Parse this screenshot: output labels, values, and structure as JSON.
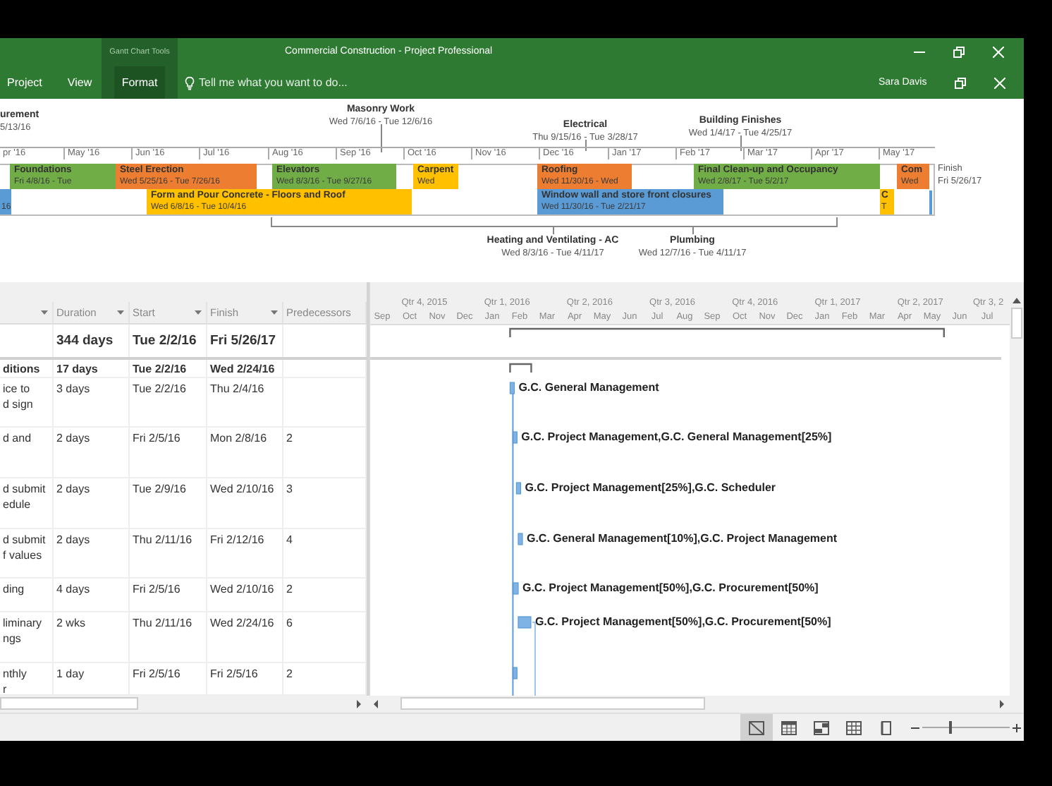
{
  "window": {
    "context_group": "Gantt Chart Tools",
    "title": "Commercial Construction - Project Professional",
    "user": "Sara Davis"
  },
  "ribbon_tabs": [
    {
      "label": "Project",
      "selected": false,
      "contextual": false
    },
    {
      "label": "View",
      "selected": false,
      "contextual": false
    },
    {
      "label": "Format",
      "selected": true,
      "contextual": true
    }
  ],
  "tell_me": {
    "placeholder": "Tell me what you want to do..."
  },
  "timeline": {
    "callouts_above": [
      {
        "name": "urement",
        "dates": "5/13/16"
      },
      {
        "name": "Masonry Work",
        "dates": "Wed 7/6/16 - Tue 12/6/16"
      },
      {
        "name": "Electrical",
        "dates": "Thu 9/15/16 - Tue 3/28/17"
      },
      {
        "name": "Building Finishes",
        "dates": "Wed 1/4/17 - Tue 4/25/17"
      }
    ],
    "months": [
      "pr '16",
      "May '16",
      "Jun '16",
      "Jul '16",
      "Aug '16",
      "Sep '16",
      "Oct '16",
      "Nov '16",
      "Dec '16",
      "Jan '17",
      "Feb '17",
      "Mar '17",
      "Apr '17",
      "May '17"
    ],
    "bars": [
      {
        "name": "Foundations",
        "dates": "Fri 4/8/16 - Tue",
        "color": "#70ad47"
      },
      {
        "name": "Steel Erection",
        "dates": "Wed 5/25/16 - Tue 7/26/16",
        "color": "#ed7d31"
      },
      {
        "name": "Elevators",
        "dates": "Wed 8/3/16 - Tue 9/27/16",
        "color": "#70ad47"
      },
      {
        "name": "Carpent",
        "dates": "Wed",
        "color": "#ffc000"
      },
      {
        "name": "Roofing",
        "dates": "Wed 11/30/16 - Wed",
        "color": "#ed7d31"
      },
      {
        "name": "Final Clean-up and Occupancy",
        "dates": "Wed 2/8/17 - Tue 5/2/17",
        "color": "#70ad47"
      },
      {
        "name": "Com",
        "dates": "Wed",
        "color": "#ed7d31"
      },
      {
        "dates": "16",
        "color": "#5b9bd5"
      },
      {
        "name": "Form and Pour Concrete - Floors and Roof",
        "dates": "Wed 6/8/16 - Tue 10/4/16",
        "color": "#ffc000"
      },
      {
        "name": "Window wall and store front closures",
        "dates": "Wed 11/30/16 - Tue 2/21/17",
        "color": "#5b9bd5"
      },
      {
        "name": "C",
        "dates": "T",
        "color": "#ffc000"
      }
    ],
    "finish": {
      "label": "Finish",
      "date": "Fri 5/26/17"
    },
    "callouts_below": [
      {
        "name": "Heating and Ventilating - AC",
        "dates": "Wed 8/3/16 - Tue 4/11/17"
      },
      {
        "name": "Plumbing",
        "dates": "Wed 12/7/16 - Tue 4/11/17"
      }
    ]
  },
  "table": {
    "columns": [
      "Duration",
      "Start",
      "Finish",
      "Predecessors"
    ],
    "rows": [
      {
        "kind": "project_summary",
        "duration": "344 days",
        "start": "Tue 2/2/16",
        "finish": "Fri 5/26/17"
      },
      {
        "kind": "summary",
        "name_lines": [
          "ditions"
        ],
        "duration": "17 days",
        "start": "Tue 2/2/16",
        "finish": "Wed 2/24/16"
      },
      {
        "kind": "task",
        "name_lines": [
          "ice to",
          "d sign"
        ],
        "duration": "3 days",
        "start": "Tue 2/2/16",
        "finish": "Thu 2/4/16",
        "resources": "G.C. General Management"
      },
      {
        "kind": "task",
        "name_lines": [
          "d and"
        ],
        "duration": "2 days",
        "start": "Fri 2/5/16",
        "finish": "Mon 2/8/16",
        "predecessors": "2",
        "resources": "G.C. Project Management,G.C. General Management[25%]"
      },
      {
        "kind": "task",
        "name_lines": [
          "d submit",
          "edule"
        ],
        "duration": "2 days",
        "start": "Tue 2/9/16",
        "finish": "Wed 2/10/16",
        "predecessors": "3",
        "resources": "G.C. Project Management[25%],G.C. Scheduler"
      },
      {
        "kind": "task",
        "name_lines": [
          "d submit",
          "f values"
        ],
        "duration": "2 days",
        "start": "Thu 2/11/16",
        "finish": "Fri 2/12/16",
        "predecessors": "4",
        "resources": "G.C. General Management[10%],G.C. Project Management"
      },
      {
        "kind": "task",
        "name_lines": [
          "ding"
        ],
        "duration": "4 days",
        "start": "Fri 2/5/16",
        "finish": "Wed 2/10/16",
        "predecessors": "2",
        "resources": "G.C. Project Management[50%],G.C. Procurement[50%]"
      },
      {
        "kind": "task",
        "name_lines": [
          "liminary",
          "ngs"
        ],
        "duration": "2 wks",
        "start": "Thu 2/11/16",
        "finish": "Wed 2/24/16",
        "predecessors": "6",
        "resources": "G.C. Project Management[50%],G.C. Procurement[50%]"
      },
      {
        "kind": "task",
        "name_lines": [
          "nthly",
          "r"
        ],
        "duration": "1 day",
        "start": "Fri 2/5/16",
        "finish": "Fri 2/5/16",
        "predecessors": "2"
      }
    ]
  },
  "gantt": {
    "quarters": [
      "Qtr 4, 2015",
      "Qtr 1, 2016",
      "Qtr 2, 2016",
      "Qtr 3, 2016",
      "Qtr 4, 2016",
      "Qtr 1, 2017",
      "Qtr 2, 2017",
      "Qtr 3, 2"
    ],
    "months": [
      "Sep",
      "Oct",
      "Nov",
      "Dec",
      "Jan",
      "Feb",
      "Mar",
      "Apr",
      "May",
      "Jun",
      "Jul",
      "Aug",
      "Sep",
      "Oct",
      "Nov",
      "Dec",
      "Jan",
      "Feb",
      "Mar",
      "Apr",
      "May",
      "Jun",
      "Jul"
    ]
  },
  "status_bar": {
    "views": [
      {
        "kind": "gantt",
        "selected": true
      },
      {
        "kind": "task_usage",
        "selected": false
      },
      {
        "kind": "team_planner",
        "selected": false
      },
      {
        "kind": "resource_sheet",
        "selected": false
      },
      {
        "kind": "report",
        "selected": false
      }
    ],
    "zoom": {
      "level": 0.32
    }
  }
}
